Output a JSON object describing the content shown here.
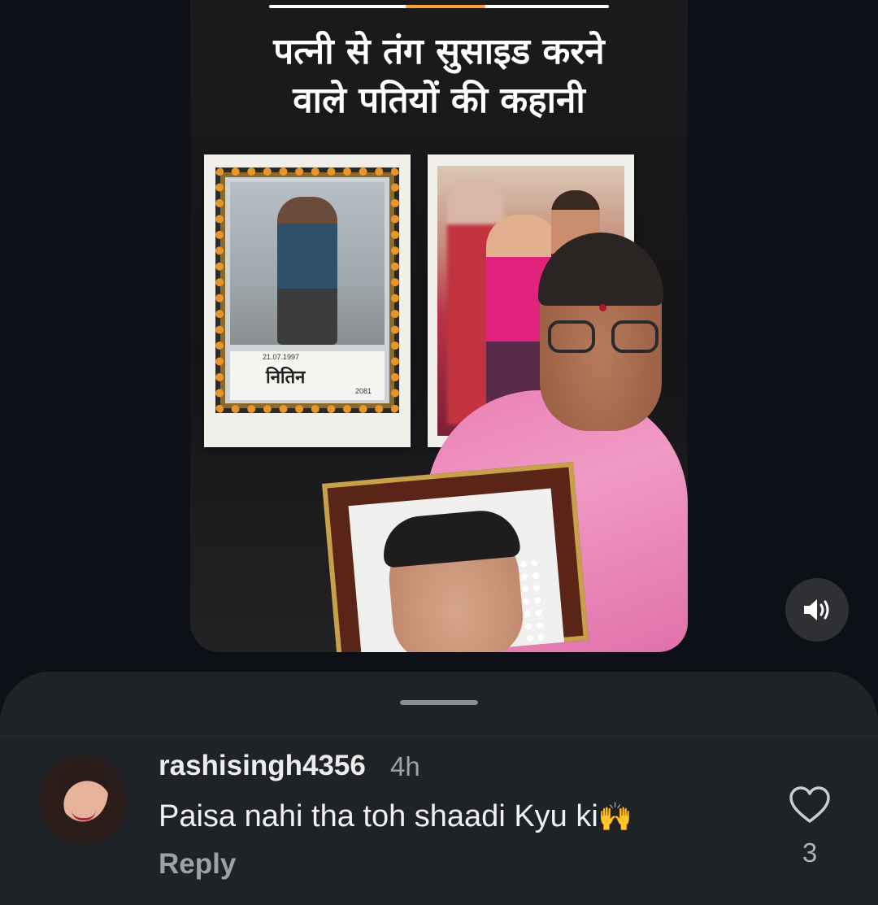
{
  "media": {
    "headline_line1": "पत्नी से तंग सुसाइड करने",
    "headline_line2": "वाले पतियों की कहानी",
    "progress_fraction": 0.23,
    "left_photo_caption_date": "21.07.1997",
    "left_photo_caption_name": "नितिन",
    "left_photo_caption_year": "2081",
    "sound_icon": "speaker-icon"
  },
  "comment": {
    "username": "rashisingh4356",
    "time": "4h",
    "text": "Paisa nahi tha toh shaadi Kyu ki",
    "emoji": "🙌",
    "reply_label": "Reply",
    "like_icon": "heart-outline-icon",
    "like_count": "3"
  },
  "colors": {
    "background": "#0d1117",
    "sheet": "#1f2227",
    "accent_progress": "#f4a234",
    "muted_text": "#9ea2a8"
  }
}
